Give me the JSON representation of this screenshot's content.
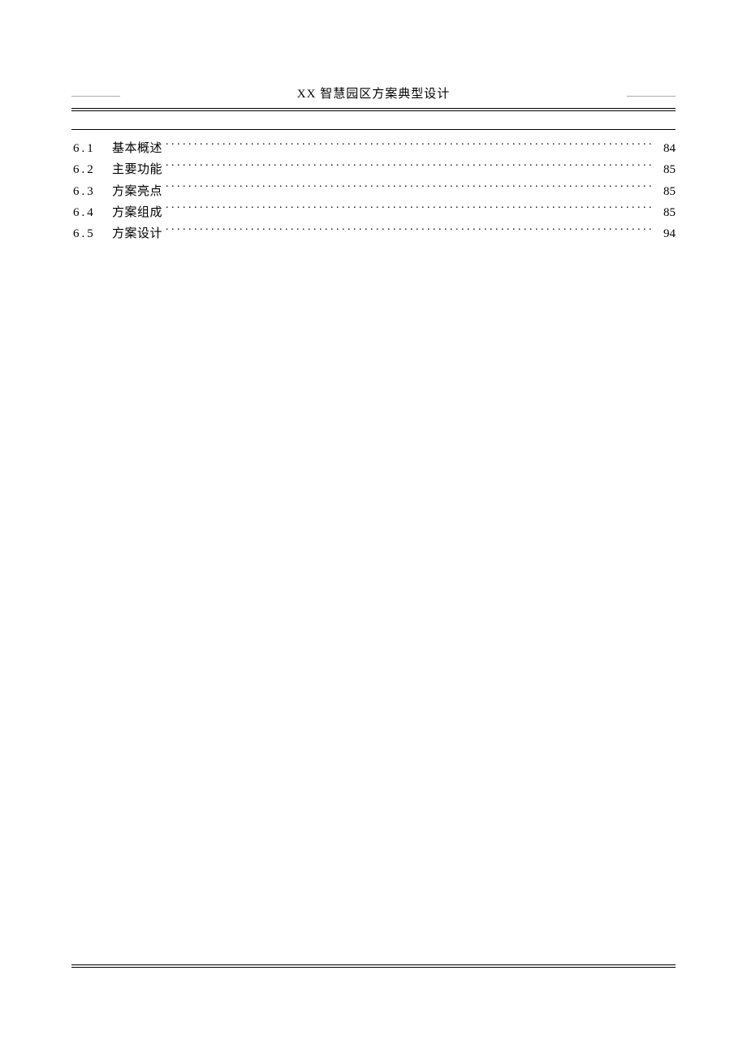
{
  "header": {
    "title": "XX 智慧园区方案典型设计"
  },
  "toc": {
    "entries": [
      {
        "number": "6.1",
        "title": "基本概述",
        "page": "84"
      },
      {
        "number": "6.2",
        "title": "主要功能",
        "page": "85"
      },
      {
        "number": "6.3",
        "title": "方案亮点",
        "page": "85"
      },
      {
        "number": "6.4",
        "title": "方案组成",
        "page": "85"
      },
      {
        "number": "6.5",
        "title": "方案设计",
        "page": "94"
      }
    ]
  }
}
